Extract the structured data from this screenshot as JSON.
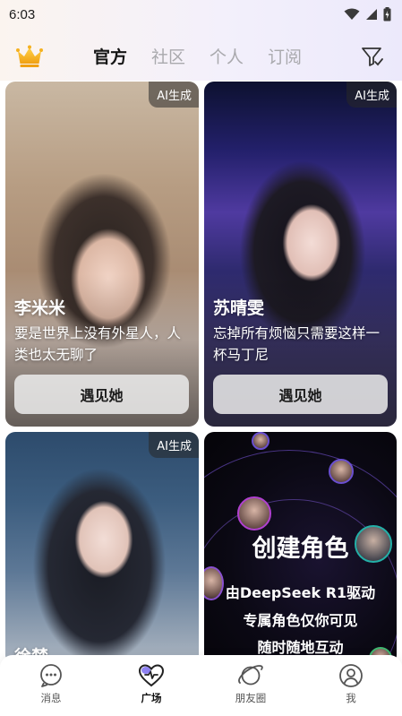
{
  "status_bar": {
    "time": "6:03"
  },
  "header": {
    "tabs": [
      {
        "label": "官方",
        "active": true
      },
      {
        "label": "社区",
        "active": false
      },
      {
        "label": "个人",
        "active": false
      },
      {
        "label": "订阅",
        "active": false
      }
    ],
    "icons": {
      "left": "crown-icon",
      "right": "filter-icon"
    },
    "accent_color": "#f5b120"
  },
  "cards": [
    {
      "badge": "AI生成",
      "name": "李米米",
      "desc": "要是世界上没有外星人，人类也太无聊了",
      "button": "遇见她"
    },
    {
      "badge": "AI生成",
      "name": "苏晴雯",
      "desc": "忘掉所有烦恼只需要这样一杯马丁尼",
      "button": "遇见她"
    },
    {
      "badge": "AI生成",
      "name": "徐楚"
    }
  ],
  "create_card": {
    "title": "创建角色",
    "lines": [
      "由DeepSeek R1驱动",
      "专属角色仅你可见",
      "随时随地互动"
    ]
  },
  "bottom_nav": [
    {
      "label": "消息",
      "icon": "message-icon",
      "active": false
    },
    {
      "label": "广场",
      "icon": "heart-icon",
      "active": true
    },
    {
      "label": "朋友圈",
      "icon": "planet-icon",
      "active": false
    },
    {
      "label": "我",
      "icon": "profile-icon",
      "active": false
    }
  ]
}
